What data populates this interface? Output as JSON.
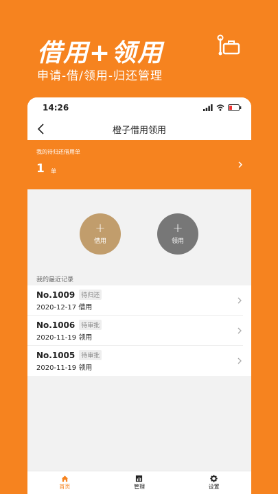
{
  "promo": {
    "title": "借用+领用",
    "subtitle": "申请-借/领用-归还管理",
    "icon": "trolley-luggage-icon"
  },
  "status_bar": {
    "time": "14:26"
  },
  "nav": {
    "title": "橙子借用领用",
    "back_icon": "chevron-left-icon"
  },
  "summary": {
    "label": "我的待归还借用单",
    "count": "1",
    "unit": "单"
  },
  "actions": {
    "borrow": {
      "symbol": "+",
      "label": "借用"
    },
    "receive": {
      "symbol": "+",
      "label": "领用"
    }
  },
  "records_title": "我的最近记录",
  "records": [
    {
      "no": "No.1009",
      "status": "待归还",
      "date": "2020-12-17",
      "type": "借用"
    },
    {
      "no": "No.1006",
      "status": "待审批",
      "date": "2020-11-19",
      "type": "领用"
    },
    {
      "no": "No.1005",
      "status": "待审批",
      "date": "2020-11-19",
      "type": "领用"
    }
  ],
  "tabs": [
    {
      "label": "首页",
      "icon": "home-icon",
      "active": true
    },
    {
      "label": "管理",
      "icon": "chart-icon",
      "active": false
    },
    {
      "label": "设置",
      "icon": "gear-icon",
      "active": false
    }
  ],
  "colors": {
    "accent": "#f6831f",
    "borrow": "#c19d6c",
    "receive": "#777777"
  }
}
